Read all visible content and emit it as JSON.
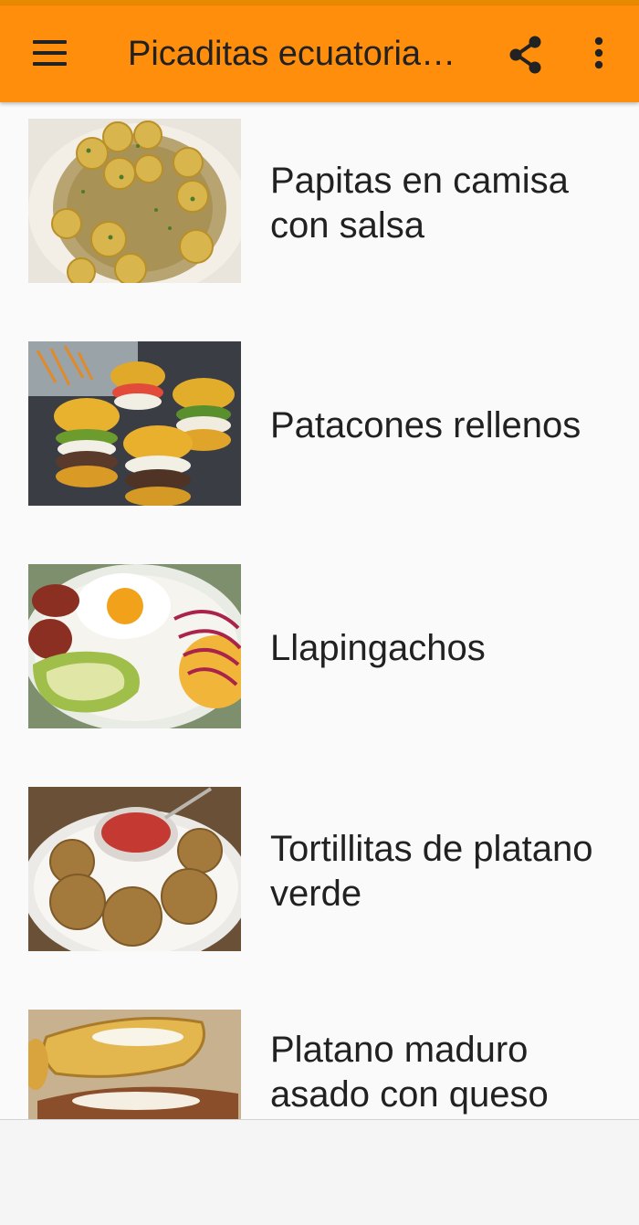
{
  "app_bar": {
    "title": "Picaditas ecuatorianas",
    "menu_icon": "hamburger-menu-icon",
    "share_icon": "share-icon",
    "more_icon": "more-vert-icon",
    "color": "#ff8e0d"
  },
  "recipes": [
    {
      "title": "Papitas en camisa con salsa",
      "image": "papitas-photo"
    },
    {
      "title": "Patacones rellenos",
      "image": "patacones-photo"
    },
    {
      "title": "Llapingachos",
      "image": "llapingachos-photo"
    },
    {
      "title": "Tortillitas de platano verde",
      "image": "tortillitas-photo"
    },
    {
      "title": "Platano maduro asado con queso",
      "image": "platano-photo"
    }
  ]
}
